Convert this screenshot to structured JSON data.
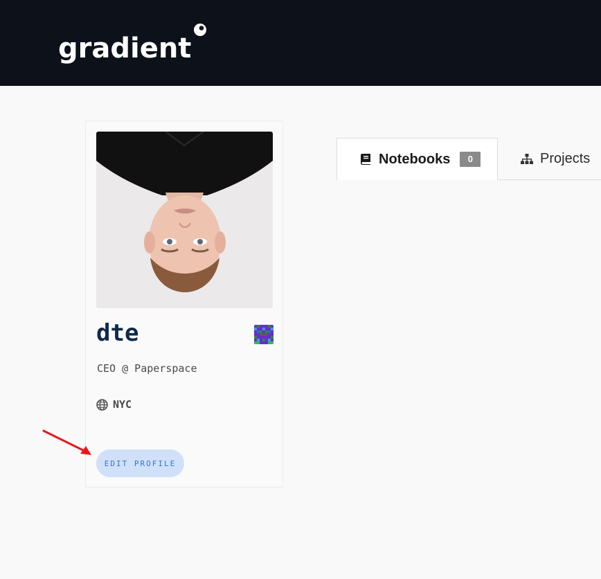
{
  "header": {
    "logo_text": "gradient"
  },
  "profile": {
    "username": "dte",
    "bio": "CEO @ Paperspace",
    "location": "NYC",
    "edit_label": "EDIT PROFILE"
  },
  "tabs": [
    {
      "label": "Notebooks",
      "count": "0",
      "icon": "book-icon",
      "active": true
    },
    {
      "label": "Projects",
      "icon": "sitemap-icon",
      "active": false
    }
  ],
  "colors": {
    "header_bg": "#0c111a",
    "username": "#0e2a4a",
    "button_bg": "#cfe0f8",
    "button_text": "#3e6fd0",
    "annotation_arrow": "#e8161a"
  }
}
